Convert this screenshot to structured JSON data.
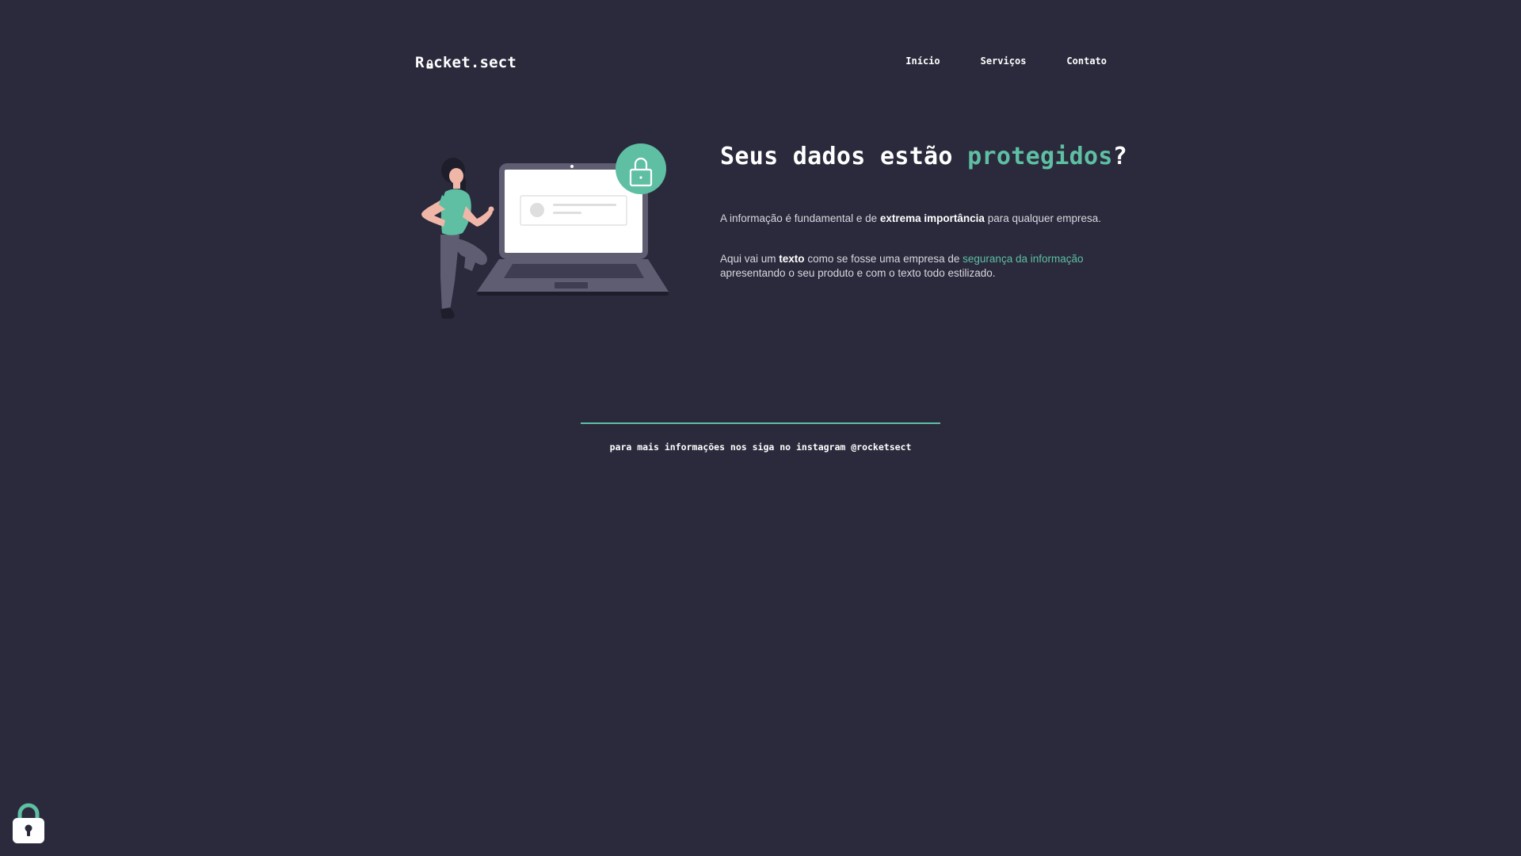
{
  "header": {
    "logo_prefix": "R",
    "logo_suffix": "cket.sect",
    "nav": [
      {
        "label": "Início"
      },
      {
        "label": "Serviços"
      },
      {
        "label": "Contato"
      }
    ]
  },
  "hero": {
    "title_part1": "Seus dados estão ",
    "title_accent": "protegidos",
    "title_part2": "?",
    "p1": {
      "pre": "A informação é fundamental e de ",
      "bold": "extrema importância",
      "post": " para qualquer empresa."
    },
    "p2": {
      "pre": "Aqui vai um ",
      "bold": "texto",
      "mid": " como se fosse uma empresa de ",
      "link": "segurança da informação",
      "post": " apresentando o seu produto e com o texto todo estilizado."
    }
  },
  "footer": {
    "text": "para mais informações nos siga no instagram @rocketsect"
  },
  "colors": {
    "background": "#2b2a3c",
    "accent": "#5ebfa3",
    "text": "#ffffff"
  },
  "icons": {
    "logo_o": "lock-icon",
    "hero_badge": "lock-icon",
    "floating_widget": "padlock-icon"
  }
}
